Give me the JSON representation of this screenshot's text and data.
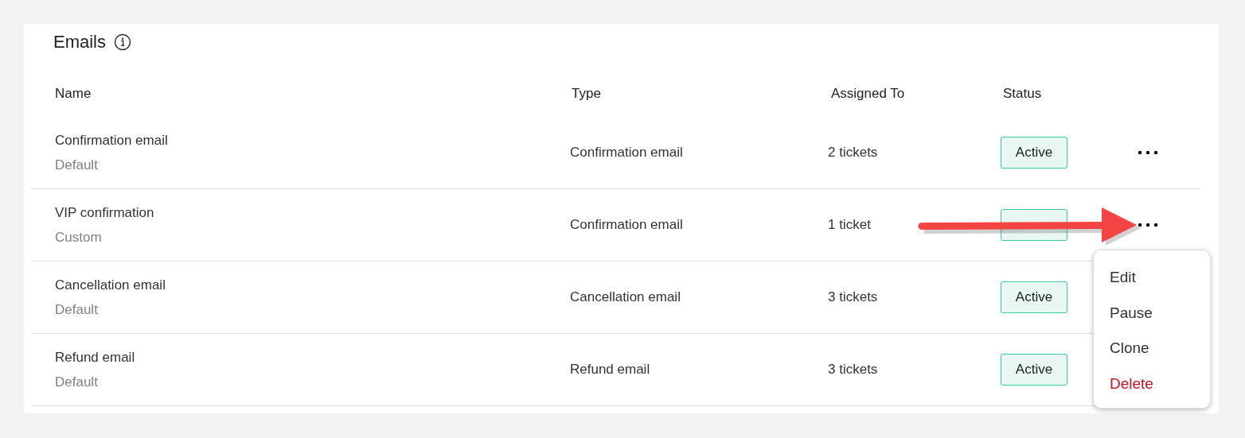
{
  "section": {
    "title": "Emails"
  },
  "table": {
    "columns": [
      "Name",
      "Type",
      "Assigned To",
      "Status"
    ],
    "rows": [
      {
        "name": "Confirmation email",
        "variant": "Default",
        "type": "Confirmation email",
        "assigned_to": "2 tickets",
        "more_button": true,
        "status_badge": true,
        "status": "Active"
      },
      {
        "name": "VIP confirmation",
        "variant": "Custom",
        "type": "Confirmation email",
        "assigned_to": "1 ticket",
        "more_button": true,
        "status_badge": true
      },
      {
        "name": "Cancellation email",
        "variant": "Default",
        "type": "Cancellation email",
        "assigned_to": "3 tickets",
        "status_badge": true,
        "status": "Active"
      },
      {
        "name": "Refund email",
        "variant": "Default",
        "type": "Refund email",
        "assigned_to": "3 tickets",
        "status_badge": true,
        "status": "Active"
      }
    ]
  },
  "row_menu": {
    "items": [
      {
        "label": "Edit",
        "kind": "normal"
      },
      {
        "label": "Pause",
        "kind": "normal"
      },
      {
        "label": "Clone",
        "kind": "normal"
      },
      {
        "label": "Delete",
        "kind": "danger"
      }
    ]
  },
  "annotation": {
    "kind": "arrow"
  }
}
